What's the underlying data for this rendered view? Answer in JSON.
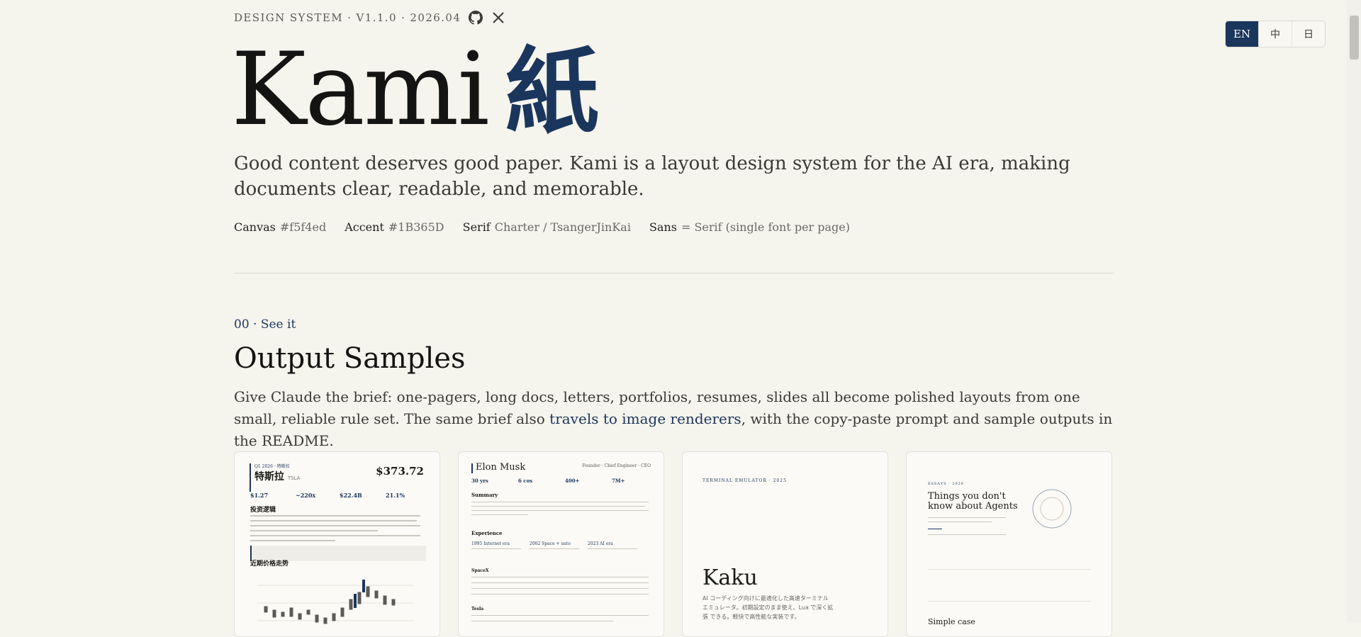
{
  "header": {
    "kicker": "DESIGN SYSTEM · V1.1.0 · 2026.04",
    "icons": [
      "github-icon",
      "x-icon"
    ]
  },
  "hero": {
    "title_latin": "Kami",
    "title_cjk": "紙"
  },
  "lead": "Good content deserves good paper. Kami is a layout design system for the AI era, making documents clear, readable, and memorable.",
  "tokens": [
    {
      "key": "Canvas",
      "value": "#f5f4ed"
    },
    {
      "key": "Accent",
      "value": "#1B365D"
    },
    {
      "key": "Serif",
      "value": "Charter / TsangerJinKai"
    },
    {
      "key": "Sans",
      "value": "= Serif (single font per page)"
    }
  ],
  "section": {
    "eyebrow": "00 · See it",
    "title": "Output Samples",
    "desc_before": "Give Claude the brief: one-pagers, long docs, letters, portfolios, resumes, slides all become polished layouts from one small, reliable rule set. The same brief also ",
    "desc_link": "travels to image renderers",
    "desc_after": ", with the copy-paste prompt and sample outputs in the README."
  },
  "cards": {
    "equity": {
      "kicker": "Q1 2026 · 特斯拉",
      "name": "特斯拉",
      "ticker": "TSLA",
      "price": "$373.72",
      "stats": [
        "$1.27",
        "~220x",
        "$22.4B",
        "21.1%"
      ],
      "section1": "投资逻辑",
      "section2": "近期价格走势"
    },
    "resume": {
      "name": "Elon Musk",
      "role": "Founder · Chief Engineer · CEO",
      "metrics": [
        "30 yrs",
        "6 cos",
        "400+",
        "7M+"
      ],
      "summary_title": "Summary",
      "experience_title": "Experience",
      "years": [
        "1995 Internet era",
        "2002 Space + auto",
        "2023 AI era"
      ],
      "row1": "SpaceX",
      "row2": "Tesla"
    },
    "slide": {
      "kicker": "TERMINAL EMULATOR · 2025",
      "title": "Kaku",
      "body": "AI コーディング向けに最適化した高速ターミナル エミュレータ。初期設定のまま使え、Lua で深く拡張 できる。軽快で高性能な実装です。"
    },
    "talk": {
      "kicker": "ESSAYS · 2026",
      "title": "Things you don't know about Agents",
      "next": "Simple case"
    }
  },
  "lang": {
    "options": [
      "EN",
      "中",
      "日"
    ],
    "active": "EN"
  },
  "colors": {
    "canvas": "#f5f4ed",
    "accent": "#1B365D"
  }
}
